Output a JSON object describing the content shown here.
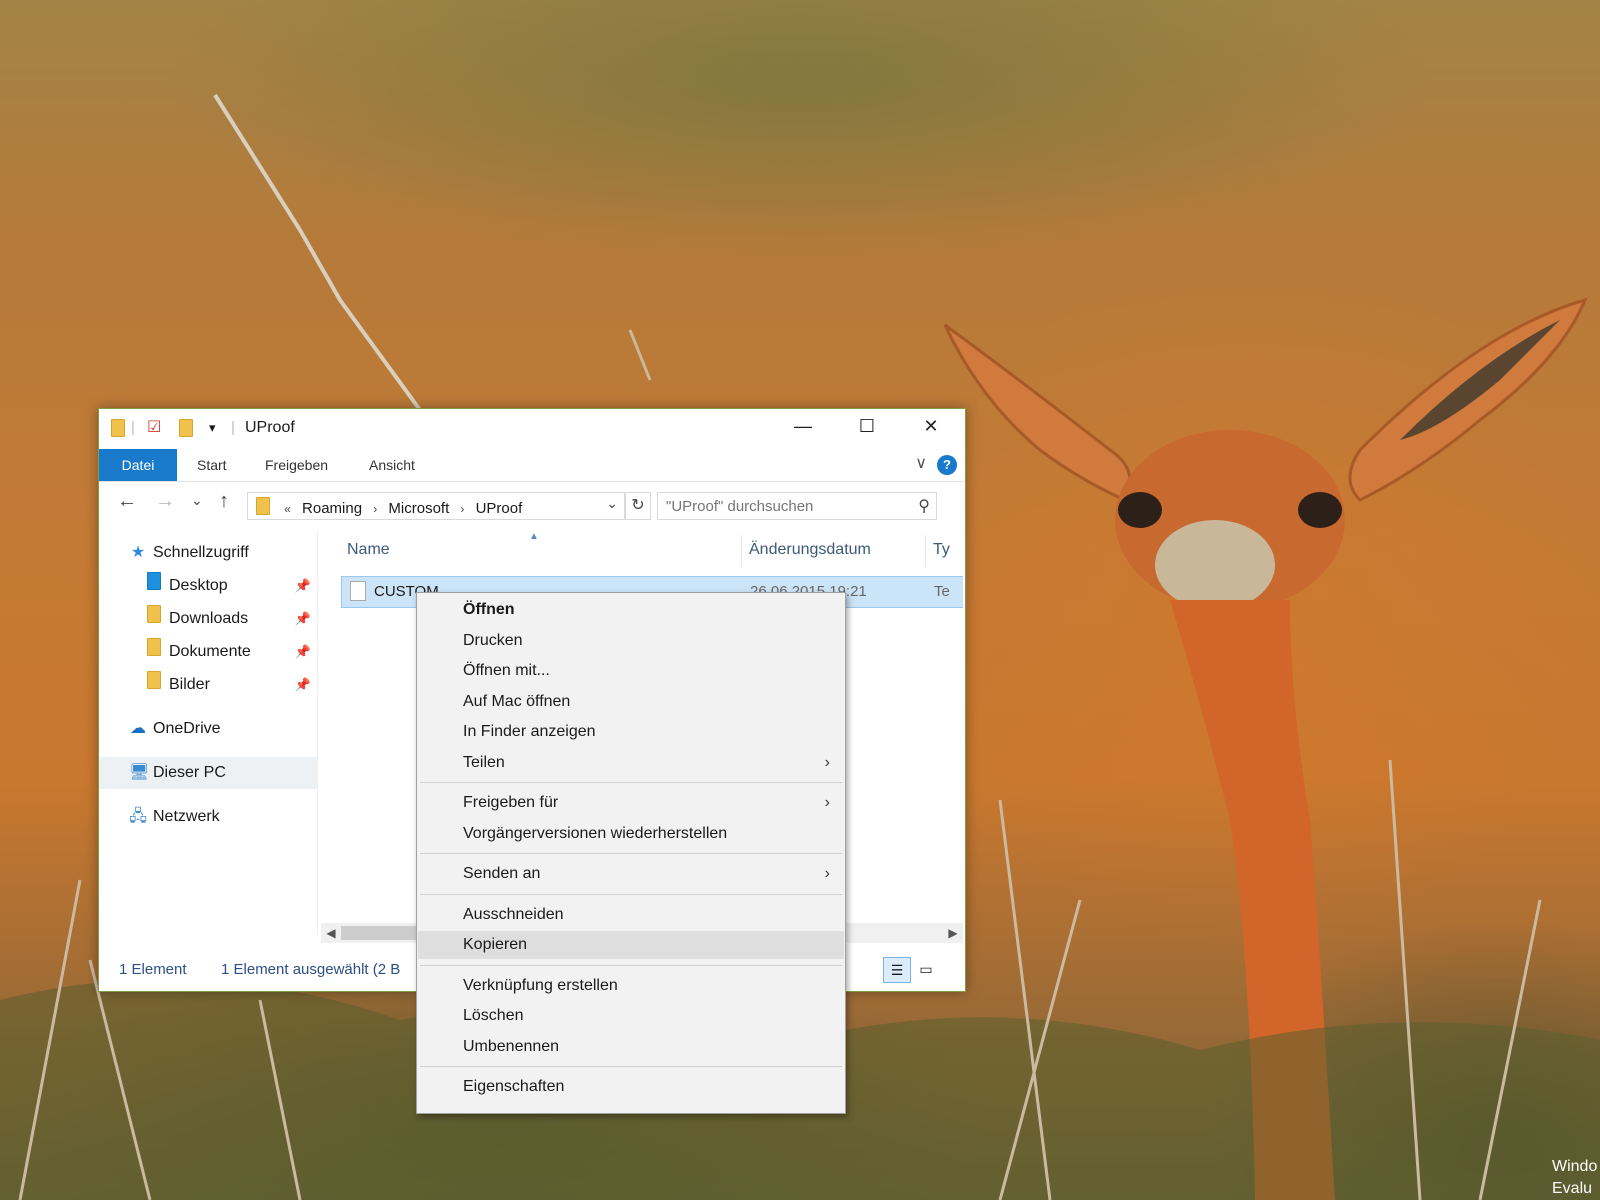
{
  "window": {
    "title": "UProof",
    "minimize_label": "—",
    "maximize_label": "☐",
    "close_label": "✕",
    "quick_access_dropdown": "▾"
  },
  "ribbon": {
    "tabs": [
      "Datei",
      "Start",
      "Freigeben",
      "Ansicht"
    ],
    "collapse_glyph": "∨",
    "help_glyph": "?"
  },
  "navigation": {
    "back": "←",
    "forward": "→",
    "recent": "⌄",
    "up": "↑",
    "address_overflow": "«",
    "path": [
      "Roaming",
      "Microsoft",
      "UProof"
    ],
    "path_separator": "›",
    "address_dropdown": "⌄",
    "refresh": "↻",
    "search_placeholder": "\"UProof\" durchsuchen",
    "search_glyph": "⚲"
  },
  "sidebar": {
    "quick_access": "Schnellzugriff",
    "pinned": [
      {
        "label": "Desktop",
        "icon": "desktop-folder-icon"
      },
      {
        "label": "Downloads",
        "icon": "downloads-folder-icon"
      },
      {
        "label": "Dokumente",
        "icon": "documents-folder-icon"
      },
      {
        "label": "Bilder",
        "icon": "pictures-folder-icon"
      }
    ],
    "pin_glyph": "📌",
    "onedrive": "OneDrive",
    "this_pc": "Dieser PC",
    "network": "Netzwerk"
  },
  "file_list": {
    "columns": [
      "Name",
      "Änderungsdatum",
      "Ty"
    ],
    "rows": [
      {
        "name": "CUSTOM",
        "date": "26.06.2015 19:21",
        "type": "Te"
      }
    ]
  },
  "statusbar": {
    "count": "1 Element",
    "selected": "1 Element ausgewählt (2 B"
  },
  "context_menu": {
    "groups": [
      [
        {
          "label": "Öffnen",
          "bold": true
        },
        {
          "label": "Drucken"
        },
        {
          "label": "Öffnen mit..."
        },
        {
          "label": "Auf Mac öffnen"
        },
        {
          "label": "In Finder anzeigen"
        },
        {
          "label": "Teilen",
          "submenu": true
        }
      ],
      [
        {
          "label": "Freigeben für",
          "submenu": true
        },
        {
          "label": "Vorgängerversionen wiederherstellen"
        }
      ],
      [
        {
          "label": "Senden an",
          "submenu": true
        }
      ],
      [
        {
          "label": "Ausschneiden"
        },
        {
          "label": "Kopieren",
          "hover": true
        }
      ],
      [
        {
          "label": "Verknüpfung erstellen"
        },
        {
          "label": "Löschen"
        },
        {
          "label": "Umbenennen"
        }
      ],
      [
        {
          "label": "Eigenschaften"
        }
      ]
    ],
    "submenu_glyph": "›"
  },
  "watermark": {
    "line1": "Windo",
    "line2": "Evalu"
  },
  "colors": {
    "accent": "#1979ca",
    "selection": "#cce4f7",
    "menu_bg": "#f2f2f2",
    "menu_hover": "#dedede"
  }
}
